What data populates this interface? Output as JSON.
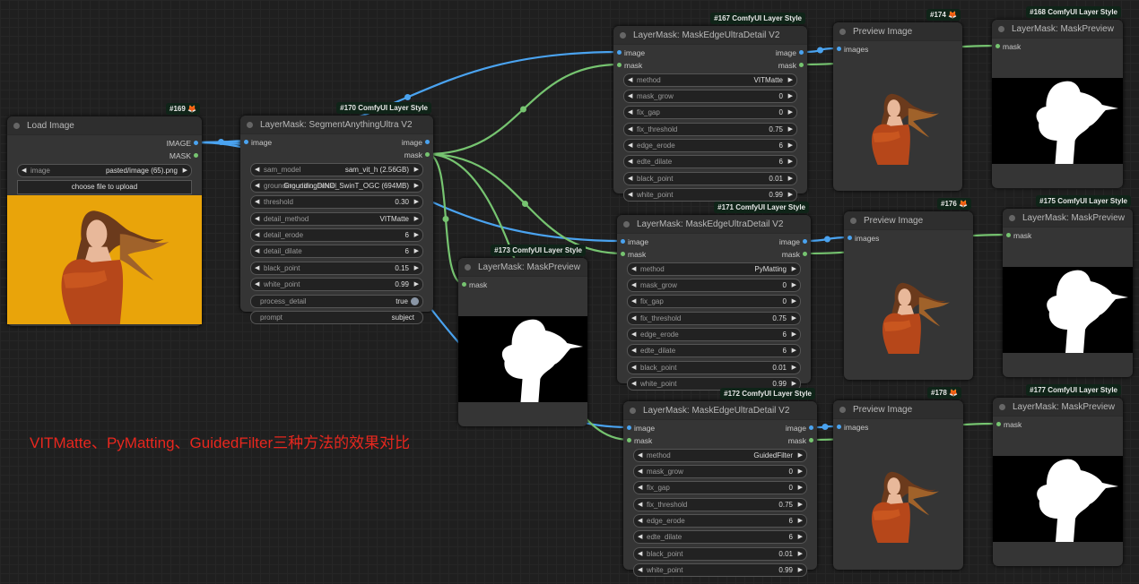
{
  "canvas": {
    "annotation": "VITMatte、PyMatting、GuidedFilter三种方法的效果对比",
    "colors": {
      "background": "#1f1f1f",
      "node": "#353535",
      "image_wire": "#4aa3f0",
      "mask_wire": "#76c470",
      "badge": "#0f2418",
      "annotation": "#e8271e",
      "photo_background": "#e9a40a"
    }
  },
  "nodes": [
    {
      "id": "169",
      "badge": "#169",
      "badge_icon": "fox-icon",
      "title": "Load Image",
      "inputs": [],
      "outputs": [
        "IMAGE",
        "MASK"
      ],
      "widgets": [
        {
          "type": "combo",
          "label": "image",
          "value": "pasted/image (65).png"
        }
      ],
      "button": "choose file to upload",
      "preview": "photo"
    },
    {
      "id": "170",
      "badge": "#170 ComfyUI Layer Style",
      "title": "LayerMask: SegmentAnythingUltra V2",
      "inputs": [
        "image"
      ],
      "outputs": [
        "image",
        "mask"
      ],
      "widgets": [
        {
          "type": "combo",
          "label": "sam_model",
          "value": "sam_vit_h (2.56GB)"
        },
        {
          "type": "combo",
          "label": "grounding_dino_model",
          "value": "GroundingDINO_SwinT_OGC (694MB)"
        },
        {
          "type": "combo",
          "label": "threshold",
          "value": "0.30"
        },
        {
          "type": "combo",
          "label": "detail_method",
          "value": "VITMatte"
        },
        {
          "type": "combo",
          "label": "detail_erode",
          "value": "6"
        },
        {
          "type": "combo",
          "label": "detail_dilate",
          "value": "6"
        },
        {
          "type": "combo",
          "label": "black_point",
          "value": "0.15"
        },
        {
          "type": "combo",
          "label": "white_point",
          "value": "0.99"
        },
        {
          "type": "toggle",
          "label": "process_detail",
          "value": "true"
        },
        {
          "type": "text",
          "label": "prompt",
          "value": "subject"
        }
      ]
    },
    {
      "id": "173",
      "badge": "#173 ComfyUI Layer Style",
      "title": "LayerMask: MaskPreview",
      "inputs": [
        "mask"
      ],
      "outputs": [],
      "widgets": [],
      "preview": "mask"
    },
    {
      "id": "167",
      "badge": "#167 ComfyUI Layer Style",
      "title": "LayerMask: MaskEdgeUltraDetail V2",
      "inputs": [
        "image",
        "mask"
      ],
      "outputs": [
        "image",
        "mask"
      ],
      "widgets": [
        {
          "type": "combo",
          "label": "method",
          "value": "VITMatte"
        },
        {
          "type": "combo",
          "label": "mask_grow",
          "value": "0"
        },
        {
          "type": "combo",
          "label": "fix_gap",
          "value": "0"
        },
        {
          "type": "combo",
          "label": "fix_threshold",
          "value": "0.75"
        },
        {
          "type": "combo",
          "label": "edge_erode",
          "value": "6"
        },
        {
          "type": "combo",
          "label": "edte_dilate",
          "value": "6"
        },
        {
          "type": "combo",
          "label": "black_point",
          "value": "0.01"
        },
        {
          "type": "combo",
          "label": "white_point",
          "value": "0.99"
        }
      ]
    },
    {
      "id": "174",
      "badge": "#174",
      "badge_icon": "fox-icon",
      "title": "Preview Image",
      "inputs": [
        "images"
      ],
      "outputs": [],
      "widgets": [],
      "preview": "cutout"
    },
    {
      "id": "168",
      "badge": "#168 ComfyUI Layer Style",
      "title": "LayerMask: MaskPreview",
      "inputs": [
        "mask"
      ],
      "outputs": [],
      "widgets": [],
      "preview": "mask"
    },
    {
      "id": "171",
      "badge": "#171 ComfyUI Layer Style",
      "title": "LayerMask: MaskEdgeUltraDetail V2",
      "inputs": [
        "image",
        "mask"
      ],
      "outputs": [
        "image",
        "mask"
      ],
      "widgets": [
        {
          "type": "combo",
          "label": "method",
          "value": "PyMatting"
        },
        {
          "type": "combo",
          "label": "mask_grow",
          "value": "0"
        },
        {
          "type": "combo",
          "label": "fix_gap",
          "value": "0"
        },
        {
          "type": "combo",
          "label": "fix_threshold",
          "value": "0.75"
        },
        {
          "type": "combo",
          "label": "edge_erode",
          "value": "6"
        },
        {
          "type": "combo",
          "label": "edte_dilate",
          "value": "6"
        },
        {
          "type": "combo",
          "label": "black_point",
          "value": "0.01"
        },
        {
          "type": "combo",
          "label": "white_point",
          "value": "0.99"
        }
      ]
    },
    {
      "id": "176",
      "badge": "#176",
      "badge_icon": "fox-icon",
      "title": "Preview Image",
      "inputs": [
        "images"
      ],
      "outputs": [],
      "widgets": [],
      "preview": "cutout"
    },
    {
      "id": "175",
      "badge": "#175 ComfyUI Layer Style",
      "title": "LayerMask: MaskPreview",
      "inputs": [
        "mask"
      ],
      "outputs": [],
      "widgets": [],
      "preview": "mask"
    },
    {
      "id": "172",
      "badge": "#172 ComfyUI Layer Style",
      "title": "LayerMask: MaskEdgeUltraDetail V2",
      "inputs": [
        "image",
        "mask"
      ],
      "outputs": [
        "image",
        "mask"
      ],
      "widgets": [
        {
          "type": "combo",
          "label": "method",
          "value": "GuidedFilter"
        },
        {
          "type": "combo",
          "label": "mask_grow",
          "value": "0"
        },
        {
          "type": "combo",
          "label": "fix_gap",
          "value": "0"
        },
        {
          "type": "combo",
          "label": "fix_threshold",
          "value": "0.75"
        },
        {
          "type": "combo",
          "label": "edge_erode",
          "value": "6"
        },
        {
          "type": "combo",
          "label": "edte_dilate",
          "value": "6"
        },
        {
          "type": "combo",
          "label": "black_point",
          "value": "0.01"
        },
        {
          "type": "combo",
          "label": "white_point",
          "value": "0.99"
        }
      ]
    },
    {
      "id": "178",
      "badge": "#178",
      "badge_icon": "fox-icon",
      "title": "Preview Image",
      "inputs": [
        "images"
      ],
      "outputs": [],
      "widgets": [],
      "preview": "cutout"
    },
    {
      "id": "177",
      "badge": "#177 ComfyUI Layer Style",
      "title": "LayerMask: MaskPreview",
      "inputs": [
        "mask"
      ],
      "outputs": [],
      "widgets": [],
      "preview": "mask"
    }
  ],
  "links": [
    {
      "from": "169",
      "out": 0,
      "to": "170",
      "in": 0,
      "kind": "image"
    },
    {
      "from": "169",
      "out": 0,
      "to": "167",
      "in": 0,
      "kind": "image"
    },
    {
      "from": "169",
      "out": 0,
      "to": "171",
      "in": 0,
      "kind": "image"
    },
    {
      "from": "169",
      "out": 0,
      "to": "172",
      "in": 0,
      "kind": "image"
    },
    {
      "from": "170",
      "out": 1,
      "to": "167",
      "in": 1,
      "kind": "mask"
    },
    {
      "from": "170",
      "out": 1,
      "to": "171",
      "in": 1,
      "kind": "mask"
    },
    {
      "from": "170",
      "out": 1,
      "to": "172",
      "in": 1,
      "kind": "mask"
    },
    {
      "from": "170",
      "out": 1,
      "to": "173",
      "in": 0,
      "kind": "mask"
    },
    {
      "from": "167",
      "out": 0,
      "to": "174",
      "in": 0,
      "kind": "image"
    },
    {
      "from": "171",
      "out": 0,
      "to": "176",
      "in": 0,
      "kind": "image"
    },
    {
      "from": "172",
      "out": 0,
      "to": "178",
      "in": 0,
      "kind": "image"
    },
    {
      "from": "167",
      "out": 1,
      "to": "168",
      "in": 0,
      "kind": "mask"
    },
    {
      "from": "171",
      "out": 1,
      "to": "175",
      "in": 0,
      "kind": "mask"
    },
    {
      "from": "172",
      "out": 1,
      "to": "177",
      "in": 0,
      "kind": "mask"
    }
  ]
}
